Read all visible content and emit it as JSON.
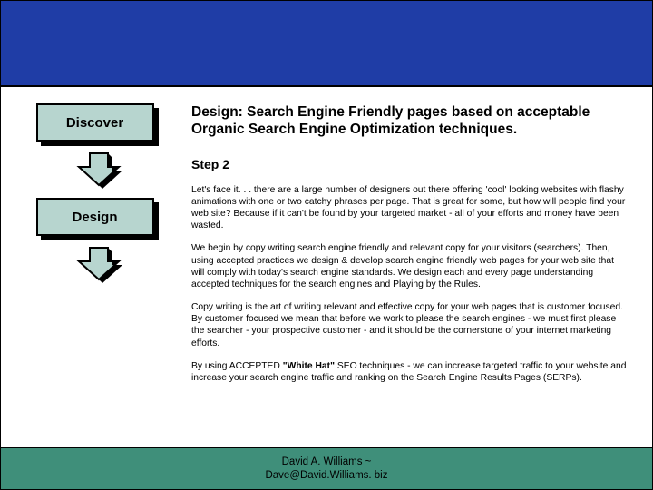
{
  "left": {
    "step1_label": "Discover",
    "step2_label": "Design"
  },
  "main": {
    "heading": "Design: Search Engine Friendly pages based on acceptable Organic Search Engine Optimization techniques.",
    "step_label": "Step 2",
    "p1": "Let's face it. . . there are a large number of designers out there offering 'cool' looking websites with flashy animations with one or two catchy phrases per page. That is great for some, but how will people find your web site? Because if it can't be found by your targeted market - all of your efforts and money have been wasted.",
    "p2": "We begin by copy writing search engine friendly and relevant copy for your visitors (searchers). Then, using accepted practices we design & develop search engine friendly web pages for your web site that will comply with today's search engine standards. We design each and every page understanding accepted techniques for the search engines and Playing by the Rules.",
    "p3": "Copy writing is the art of writing relevant and effective copy for your web pages that is customer focused. By customer focused we mean that before we work to please the search engines - we must first please the searcher - your prospective customer - and it should be the cornerstone of your internet marketing efforts.",
    "p4_a": "By using ACCEPTED ",
    "p4_b": "\"White Hat\"",
    "p4_c": " SEO techniques - we can increase targeted traffic to your website and increase your search engine traffic and ranking on the Search Engine Results Pages (SERPs)."
  },
  "footer": {
    "line1": "David A. Williams ~",
    "line2": "Dave@David.Williams. biz"
  }
}
